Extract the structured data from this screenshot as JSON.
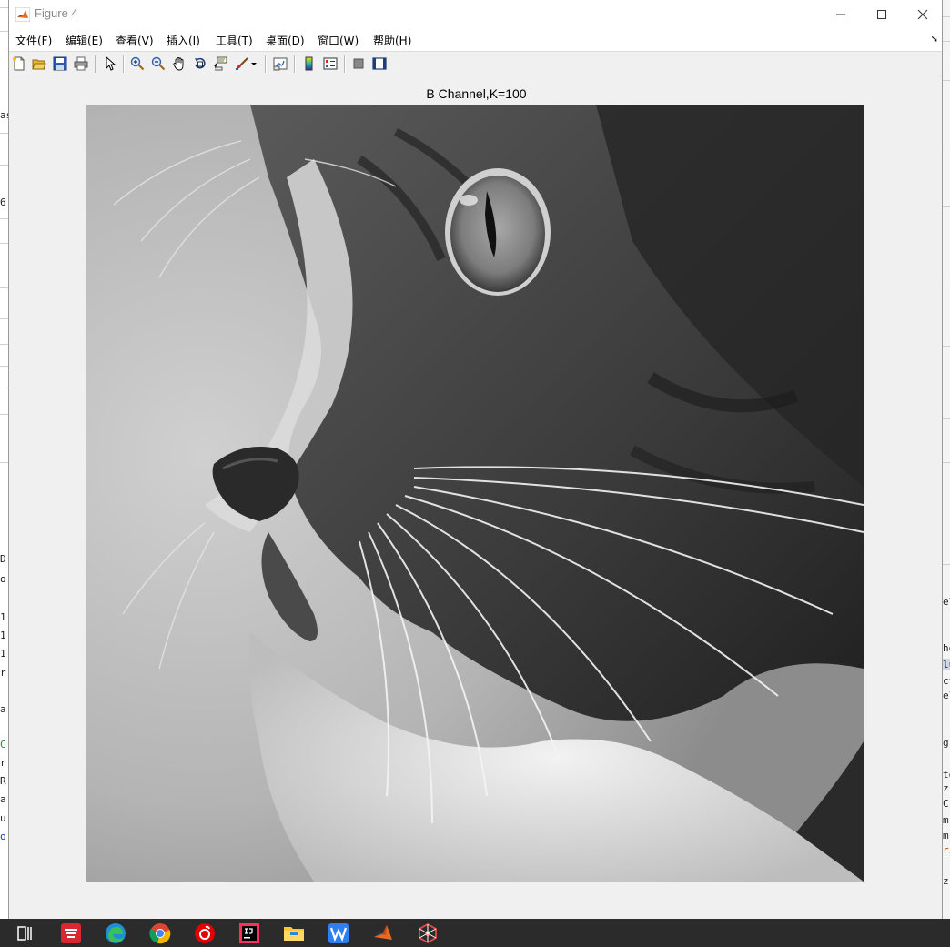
{
  "window": {
    "title": "Figure 4",
    "buttons": [
      "minimize",
      "maximize",
      "close"
    ]
  },
  "menu": {
    "items": [
      {
        "label": "文件(F)"
      },
      {
        "label": "编辑(E)"
      },
      {
        "label": "查看(V)"
      },
      {
        "label": "插入(I)"
      },
      {
        "label": "工具(T)"
      },
      {
        "label": "桌面(D)"
      },
      {
        "label": "窗口(W)"
      },
      {
        "label": "帮助(H)"
      }
    ]
  },
  "toolbar": {
    "icons": [
      "new-figure-icon",
      "open-file-icon",
      "save-icon",
      "print-icon",
      "select-arrow-icon",
      "zoom-in-icon",
      "zoom-out-icon",
      "pan-hand-icon",
      "rotate-3d-icon",
      "data-cursor-icon",
      "brush-icon",
      "brush-dropdown-icon",
      "link-plot-icon",
      "colorbar-icon",
      "legend-icon",
      "hide-plot-tools-icon",
      "show-plot-tools-icon"
    ]
  },
  "axes": {
    "title": "B Channel,K=100",
    "image_description": "grayscale close-up of a cat's face (eye, nose, whiskers)"
  },
  "taskbar": {
    "apps": [
      "task-view-icon",
      "youdao-icon",
      "edge-icon",
      "chrome-icon",
      "netease-music-icon",
      "intellij-icon",
      "file-explorer-icon",
      "wps-icon",
      "matlab-icon",
      "network-app-icon"
    ]
  },
  "background_window_left": {
    "lines": [
      "as",
      "6",
      "D",
      "o",
      "1",
      "1",
      "1",
      "r",
      "a",
      "C",
      "r",
      "R",
      "a",
      "u",
      "o"
    ]
  },
  "background_window_right": {
    "lines": [
      "el",
      "ho",
      "lu",
      "ct",
      "el",
      "g",
      "to",
      "z",
      "C",
      "m",
      "m",
      "rı",
      "z"
    ]
  },
  "colors": {
    "figure_bg": "#f0f0f0",
    "taskbar_bg": "#2b2b2b",
    "matlab_orange": "#e66a1f",
    "matlab_blue": "#1f5bb5"
  }
}
